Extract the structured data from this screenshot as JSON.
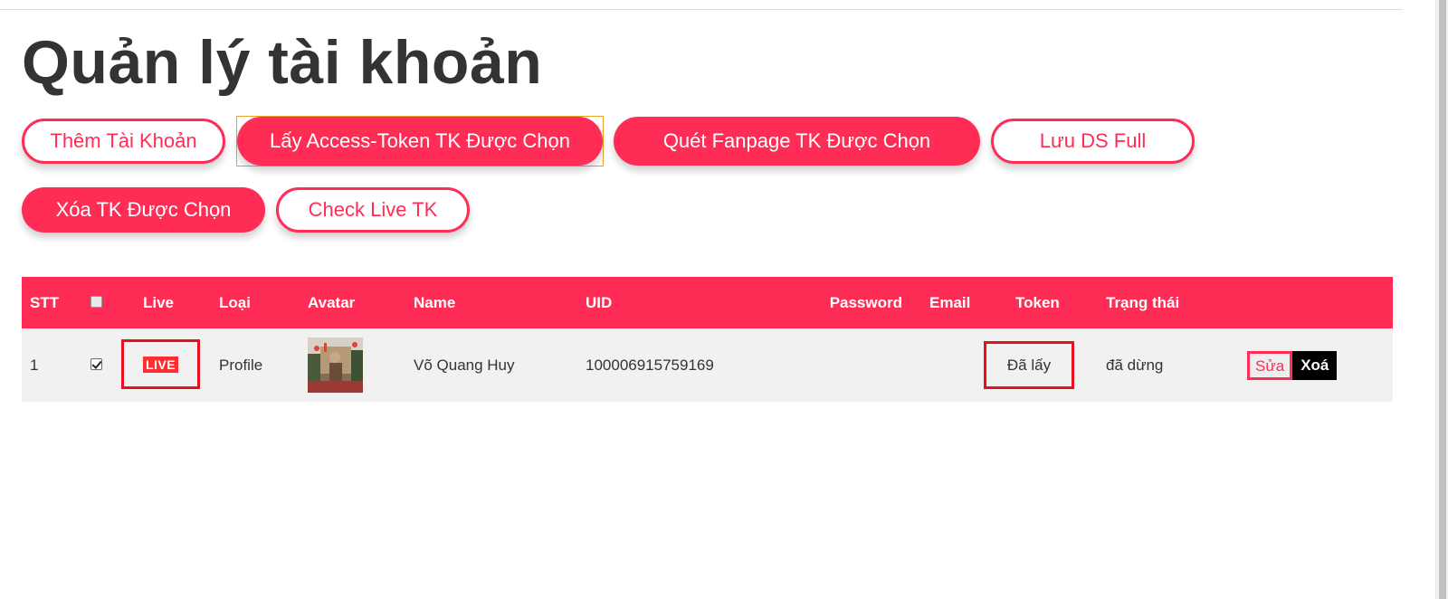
{
  "page": {
    "title": "Quản lý tài khoản"
  },
  "toolbar": {
    "add_account": "Thêm Tài Khoản",
    "get_token": "Lấy Access-Token TK Được Chọn",
    "scan_fanpage": "Quét Fanpage TK Được Chọn",
    "save_full": "Lưu DS Full",
    "delete_selected": "Xóa TK Được Chọn",
    "check_live": "Check Live TK"
  },
  "table": {
    "headers": {
      "stt": "STT",
      "live": "Live",
      "type": "Loại",
      "avatar": "Avatar",
      "name": "Name",
      "uid": "UID",
      "password": "Password",
      "email": "Email",
      "token": "Token",
      "status": "Trạng thái"
    },
    "rows": [
      {
        "stt": "1",
        "checked": true,
        "live": "LIVE",
        "type": "Profile",
        "name": "Võ Quang Huy",
        "uid": "100006915759169",
        "password": "",
        "email": "",
        "token": "Đã lấy",
        "status": "đã dừng",
        "edit_label": "Sửa",
        "delete_label": "Xoá"
      }
    ]
  },
  "colors": {
    "accent": "#ff2d55",
    "highlight_border": "#e8101e",
    "live_badge": "#ff2d2d"
  }
}
